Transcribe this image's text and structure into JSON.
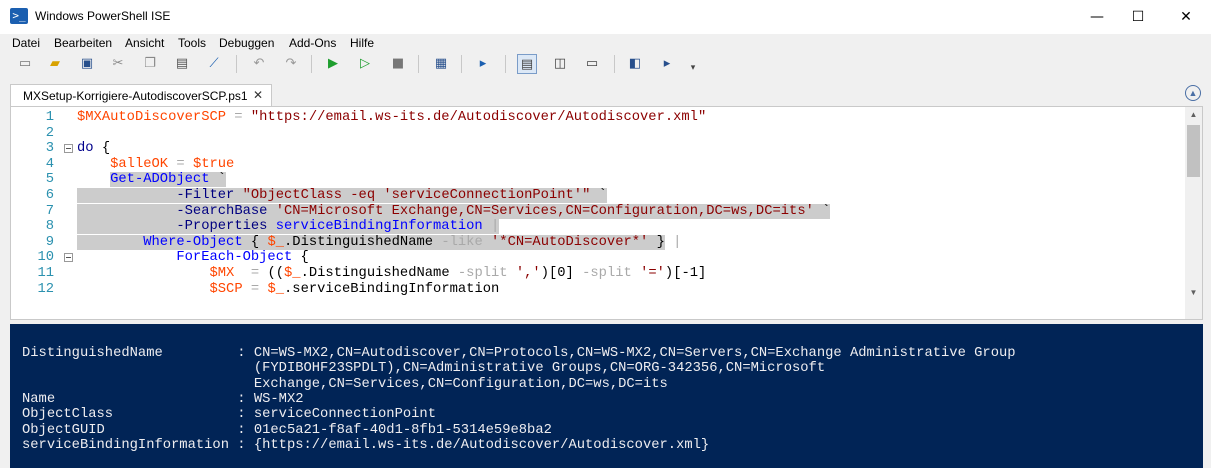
{
  "window": {
    "title": "Windows PowerShell ISE",
    "minimize": "—",
    "maximize": "☐",
    "close": "✕"
  },
  "menu": [
    "Datei",
    "Bearbeiten",
    "Ansicht",
    "Tools",
    "Debuggen",
    "Add-Ons",
    "Hilfe"
  ],
  "tab": {
    "label": "MXSetup-Korrigiere-AutodiscoverSCP.ps1",
    "close": "✕"
  },
  "editor": {
    "line_numbers": [
      "1",
      "2",
      "3",
      "4",
      "5",
      "6",
      "7",
      "8",
      "9",
      "10",
      "11",
      "12"
    ],
    "lines": [
      [
        {
          "t": "$MXAutoDiscoverSCP",
          "c": "v"
        },
        {
          "t": " = ",
          "c": "o"
        },
        {
          "t": "\"https://email.ws-its.de/Autodiscover/Autodiscover.xml\"",
          "c": "s"
        }
      ],
      [],
      [
        {
          "t": "do",
          "c": "k"
        },
        {
          "t": " {",
          "c": "t"
        }
      ],
      [
        {
          "t": "    ",
          "c": "t"
        },
        {
          "t": "$alleOK",
          "c": "v"
        },
        {
          "t": " = ",
          "c": "o"
        },
        {
          "t": "$true",
          "c": "v"
        }
      ],
      [
        {
          "t": "    ",
          "c": "t"
        },
        {
          "t": "Get-ADObject",
          "c": "c",
          "sel": true
        },
        {
          "t": " `",
          "c": "t",
          "sel": true
        }
      ],
      [
        {
          "t": "    ",
          "c": "t",
          "sel": true
        },
        {
          "t": "        ",
          "c": "t",
          "sel": true
        },
        {
          "t": "-Filter",
          "c": "p",
          "sel": true
        },
        {
          "t": " ",
          "c": "t",
          "sel": true
        },
        {
          "t": "\"ObjectClass -eq 'serviceConnectionPoint'\"",
          "c": "s",
          "sel": true
        },
        {
          "t": " `",
          "c": "t",
          "sel": true
        }
      ],
      [
        {
          "t": "            ",
          "c": "t",
          "sel": true
        },
        {
          "t": "-SearchBase",
          "c": "p",
          "sel": true
        },
        {
          "t": " ",
          "c": "t",
          "sel": true
        },
        {
          "t": "'CN=Microsoft Exchange,CN=Services,CN=Configuration,DC=ws,DC=its'",
          "c": "s",
          "sel": true
        },
        {
          "t": " `",
          "c": "t",
          "sel": true
        }
      ],
      [
        {
          "t": "            ",
          "c": "t",
          "sel": true
        },
        {
          "t": "-Properties",
          "c": "p",
          "sel": true
        },
        {
          "t": " ",
          "c": "t",
          "sel": true
        },
        {
          "t": "serviceBindingInformation",
          "c": "c",
          "sel": true
        },
        {
          "t": " |",
          "c": "o",
          "sel": true
        }
      ],
      [
        {
          "t": "        ",
          "c": "t",
          "sel": true
        },
        {
          "t": "Where-Object",
          "c": "c",
          "sel": true
        },
        {
          "t": " { ",
          "c": "t",
          "sel": true
        },
        {
          "t": "$_",
          "c": "v",
          "sel": true
        },
        {
          "t": ".DistinguishedName ",
          "c": "t",
          "sel": true
        },
        {
          "t": "-like",
          "c": "o",
          "sel": true
        },
        {
          "t": " ",
          "c": "t",
          "sel": true
        },
        {
          "t": "'*CN=AutoDiscover*'",
          "c": "s",
          "sel": true
        },
        {
          "t": " }",
          "c": "t",
          "sel": true
        },
        {
          "t": " |",
          "c": "o"
        }
      ],
      [
        {
          "t": "            ",
          "c": "t"
        },
        {
          "t": "ForEach-Object",
          "c": "c"
        },
        {
          "t": " {",
          "c": "t"
        }
      ],
      [
        {
          "t": "                ",
          "c": "t"
        },
        {
          "t": "$MX",
          "c": "v"
        },
        {
          "t": "  ",
          "c": "t"
        },
        {
          "t": "=",
          "c": "o"
        },
        {
          "t": " ((",
          "c": "t"
        },
        {
          "t": "$_",
          "c": "v"
        },
        {
          "t": ".DistinguishedName ",
          "c": "t"
        },
        {
          "t": "-split",
          "c": "o"
        },
        {
          "t": " ",
          "c": "t"
        },
        {
          "t": "','",
          "c": "s"
        },
        {
          "t": ")[0] ",
          "c": "t"
        },
        {
          "t": "-split",
          "c": "o"
        },
        {
          "t": " ",
          "c": "t"
        },
        {
          "t": "'='",
          "c": "s"
        },
        {
          "t": ")[-1]",
          "c": "t"
        }
      ],
      [
        {
          "t": "                ",
          "c": "t"
        },
        {
          "t": "$SCP",
          "c": "v"
        },
        {
          "t": " ",
          "c": "t"
        },
        {
          "t": "=",
          "c": "o"
        },
        {
          "t": " ",
          "c": "t"
        },
        {
          "t": "$_",
          "c": "v"
        },
        {
          "t": ".serviceBindingInformation",
          "c": "t"
        }
      ]
    ],
    "folds": [
      false,
      false,
      true,
      false,
      false,
      false,
      false,
      false,
      false,
      true,
      false,
      false
    ]
  },
  "console": {
    "lines": [
      "DistinguishedName         : CN=WS-MX2,CN=Autodiscover,CN=Protocols,CN=WS-MX2,CN=Servers,CN=Exchange Administrative Group",
      "                            (FYDIBOHF23SPDLT),CN=Administrative Groups,CN=ORG-342356,CN=Microsoft",
      "                            Exchange,CN=Services,CN=Configuration,DC=ws,DC=its",
      "Name                      : WS-MX2",
      "ObjectClass               : serviceConnectionPoint",
      "ObjectGUID                : 01ec5a21-f8af-40d1-8fb1-5314e59e8ba2",
      "serviceBindingInformation : {https://email.ws-its.de/Autodiscover/Autodiscover.xml}"
    ]
  },
  "colors": {
    "console_bg": "#012456",
    "selection": "#cccccc",
    "line_number": "#2b91af"
  },
  "icons": [
    "new-icon",
    "open-icon",
    "save-icon",
    "cut-icon",
    "copy-icon",
    "paste-icon",
    "clear-console-icon",
    "undo-icon",
    "redo-icon",
    "run-script-icon",
    "run-selection-icon",
    "stop-icon",
    "new-remote-tab-icon",
    "start-powershell-icon",
    "layout-top-icon",
    "layout-right-icon",
    "layout-max-icon",
    "show-script-pane-icon",
    "show-commands-icon"
  ]
}
